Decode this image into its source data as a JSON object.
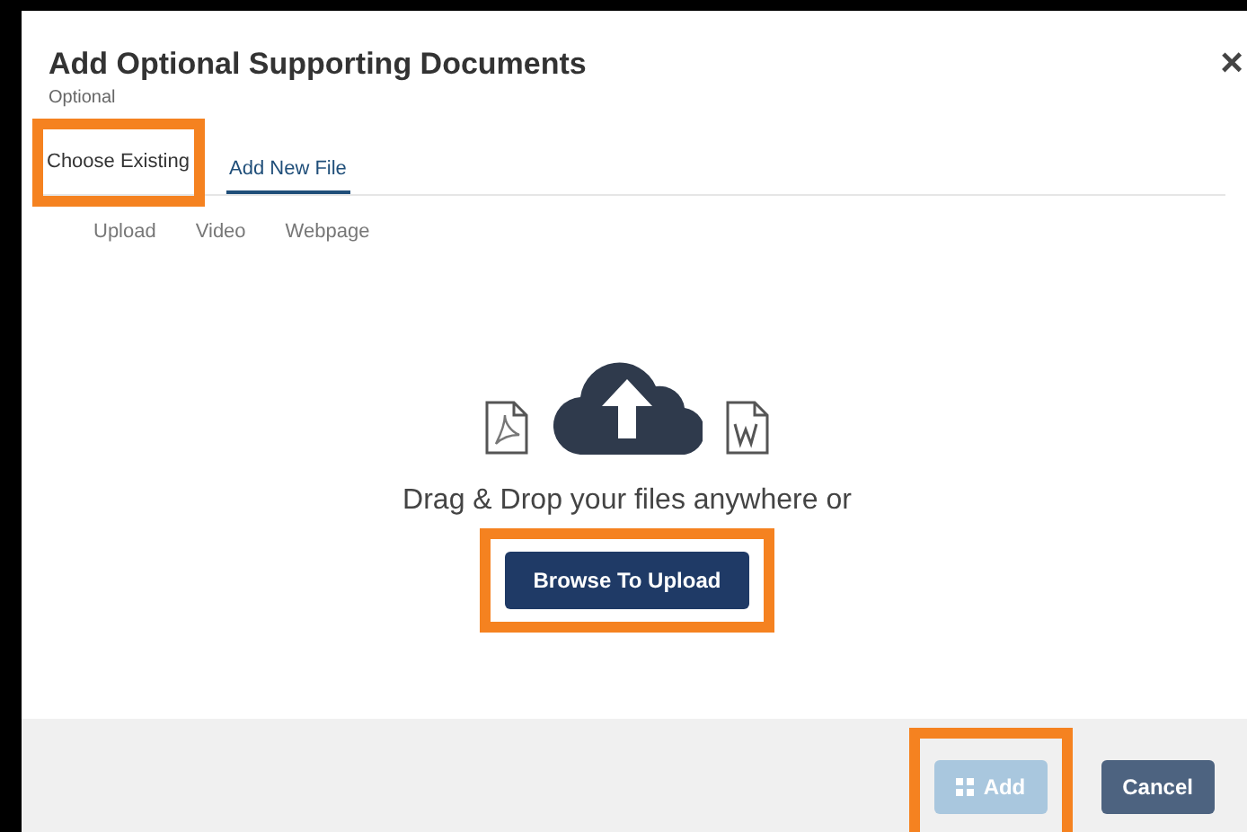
{
  "dialog": {
    "title": "Add Optional Supporting Documents",
    "subtitle": "Optional",
    "close": "×"
  },
  "tabs": [
    {
      "label": "Choose Existing",
      "selected": false,
      "highlighted": true
    },
    {
      "label": "Add New File",
      "selected": true,
      "highlighted": false
    }
  ],
  "sub_tabs": [
    {
      "label": "Upload"
    },
    {
      "label": "Video"
    },
    {
      "label": "Webpage"
    }
  ],
  "drop_zone": {
    "text": "Drag & Drop your files anywhere or",
    "button": {
      "label": "Browse To Upload",
      "highlighted": true
    }
  },
  "footer": {
    "buttons": [
      {
        "label": "Add",
        "kind": "primary",
        "disabled": true,
        "highlighted": true
      },
      {
        "label": "Cancel",
        "kind": "secondary",
        "disabled": false,
        "highlighted": false
      }
    ]
  }
}
